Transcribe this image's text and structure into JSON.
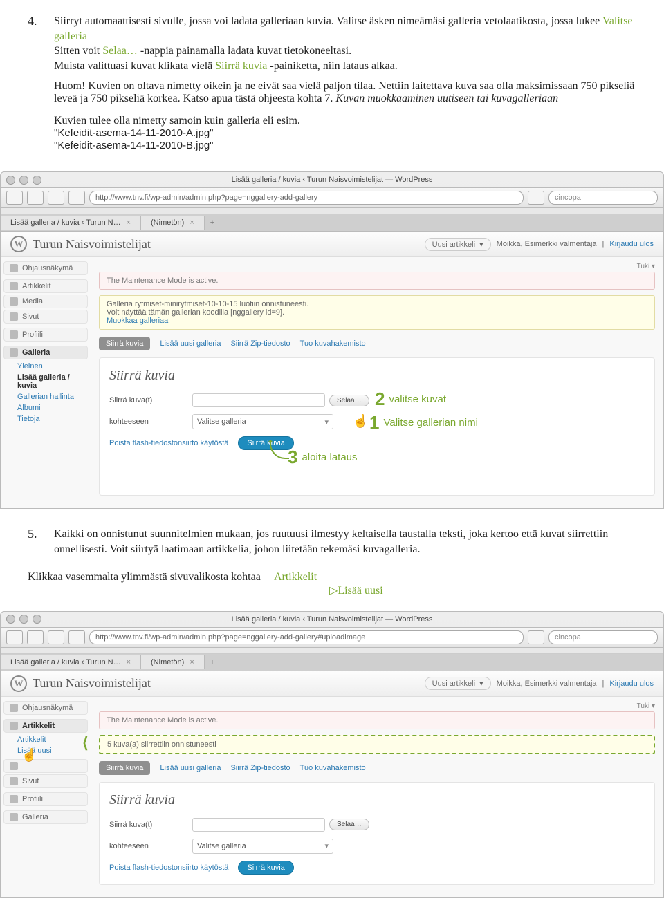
{
  "step4": {
    "num": "4.",
    "line1a": "Siirryt automaattisesti sivulle, jossa voi ladata galleriaan kuvia. Valitse äsken nimeämäsi galleria vetolaatikosta, jossa lukee ",
    "valitse_galleria": "Valitse galleria",
    "line2a": "Sitten voit ",
    "selaa": "Selaa…",
    "line2b": " -nappia painamalla ladata kuvat tietokoneeltasi.",
    "line3a": "Muista valittuasi kuvat klikata vielä ",
    "siirra": "Siirrä kuvia",
    "line3b": " -painiketta, niin lataus alkaa.",
    "huom": "Huom! Kuvien on oltava nimetty oikein ja ne eivät saa vielä paljon tilaa. Nettiin laitettava kuva saa olla maksimissaan 750 pikseliä leveä ja 750 pikseliä korkea. Katso apua tästä ohjeesta kohta 7. ",
    "huom_italic": "Kuvan muokkaaminen uutiseen tai kuvagalleriaan",
    "line5": "Kuvien tulee olla nimetty samoin kuin galleria eli esim.",
    "fn1": "\"Kefeidit-asema-14-11-2010-A.jpg\"",
    "fn2": "\"Kefeidit-asema-14-11-2010-B.jpg\""
  },
  "browser": {
    "title": "Lisää galleria / kuvia ‹ Turun Naisvoimistelijat — WordPress",
    "url": "http://www.tnv.fi/wp-admin/admin.php?page=nggallery-add-gallery",
    "url2": "http://www.tnv.fi/wp-admin/admin.php?page=nggallery-add-gallery#uploadimage",
    "search": "cincopa",
    "tab": "Lisää galleria / kuvia ‹ Turun N…",
    "tab2": "(Nimetön)"
  },
  "wp": {
    "site": "Turun Naisvoimistelijat",
    "newpost": "Uusi artikkeli",
    "greeting": "Moikka, Esimerkki valmentaja",
    "logout": "Kirjaudu ulos",
    "tuki": "Tuki ▾",
    "side": {
      "dashboard": "Ohjausnäkymä",
      "posts": "Artikkelit",
      "media": "Media",
      "pages": "Sivut",
      "profile": "Profiili",
      "galleria": "Galleria",
      "g1": "Yleinen",
      "g2": "Lisää galleria / kuvia",
      "g3": "Gallerian hallinta",
      "g4": "Albumi",
      "g5": "Tietoja",
      "posts_sub1": "Artikkelit",
      "posts_sub2": "Lisää uusi"
    },
    "notice": "The Maintenance Mode is active.",
    "success1a": "Galleria rytmiset-minirytmiset-10-10-15 luotiin onnistuneesti.",
    "success1b": "Voit näyttää tämän gallerian koodilla [nggallery id=9].",
    "success1c": "Muokkaa galleriaa",
    "success2": "5 kuva(a) siirrettiin onnistuneesti",
    "tabs": {
      "t1": "Siirrä kuvia",
      "t2": "Lisää uusi galleria",
      "t3": "Siirrä Zip-tiedosto",
      "t4": "Tuo kuvahakemisto"
    },
    "panel": {
      "h": "Siirrä kuvia",
      "l1": "Siirrä kuva(t)",
      "browse": "Selaa…",
      "l2": "kohteeseen",
      "select": "Valitse galleria",
      "flash": "Poista flash-tiedostonsiirto käytöstä",
      "submit": "Siirrä kuvia"
    }
  },
  "callouts": {
    "c2": "valitse kuvat",
    "c1": "Valitse gallerian nimi",
    "c3": "aloita lataus"
  },
  "step5": {
    "num": "5.",
    "text": "Kaikki on onnistunut suunnitelmien mukaan, jos ruutuusi ilmestyy keltaisella taustalla teksti, joka kertoo että kuvat siirrettiin onnellisesti. Voit siirtyä laatimaan artikkelia, johon liitetään tekemäsi kuvagalleria.",
    "click": "Klikkaa vasemmalta ylimmästä sivuvalikosta kohtaa",
    "m1": "Artikkelit",
    "m2": "Lisää uusi",
    "tri": "▷"
  }
}
